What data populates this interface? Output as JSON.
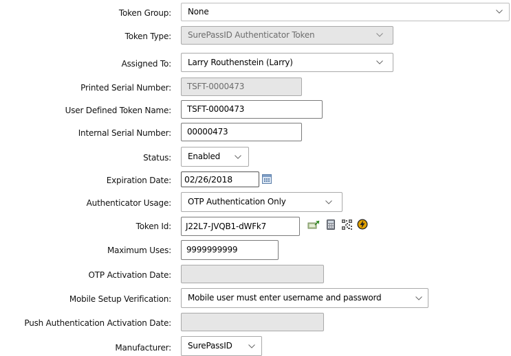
{
  "form": {
    "token_group": {
      "label": "Token Group:",
      "value": "None"
    },
    "token_type": {
      "label": "Token Type:",
      "value": "SurePassID Authenticator Token"
    },
    "assigned_to": {
      "label": "Assigned To:",
      "value": "Larry Routhenstein (Larry)"
    },
    "printed_serial": {
      "label": "Printed Serial Number:",
      "value": "TSFT-0000473"
    },
    "user_token_name": {
      "label": "User Defined Token Name:",
      "value": "TSFT-0000473"
    },
    "internal_serial": {
      "label": "Internal Serial Number:",
      "value": "00000473"
    },
    "status": {
      "label": "Status:",
      "value": "Enabled"
    },
    "expiration_date": {
      "label": "Expiration Date:",
      "value": "02/26/2018"
    },
    "authenticator_usage": {
      "label": "Authenticator Usage:",
      "value": "OTP Authentication Only"
    },
    "token_id": {
      "label": "Token Id:",
      "value": "J22L7-JVQB1-dWFk7"
    },
    "maximum_uses": {
      "label": "Maximum Uses:",
      "value": "9999999999"
    },
    "otp_activation_date": {
      "label": "OTP Activation Date:",
      "value": ""
    },
    "mobile_setup_verification": {
      "label": "Mobile Setup Verification:",
      "value": "Mobile user must enter username and password"
    },
    "push_activation_date": {
      "label": "Push Authentication Activation Date:",
      "value": ""
    },
    "manufacturer": {
      "label": "Manufacturer:",
      "value": "SurePassID"
    }
  },
  "icons": {
    "calendar": "calendar-icon",
    "token_id_actions": [
      "send-token-icon",
      "calculator-icon",
      "qr-code-icon",
      "flash-icon"
    ]
  },
  "colors": {
    "readonly_bg": "#e6e6e6",
    "border": "#a9a9a9",
    "flash_icon": "#e0a000"
  }
}
